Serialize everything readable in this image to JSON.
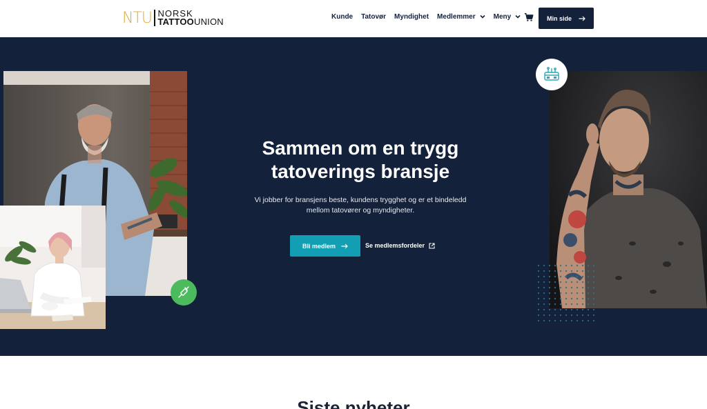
{
  "header": {
    "logo": {
      "mark": "NTU",
      "word1": "NORSK",
      "word2_bold": "TATTOO",
      "word2_rest": "UNION"
    },
    "nav": [
      {
        "label": "Kunde",
        "dropdown": false
      },
      {
        "label": "Tatovør",
        "dropdown": false
      },
      {
        "label": "Myndighet",
        "dropdown": false
      },
      {
        "label": "Medlemmer",
        "dropdown": true
      },
      {
        "label": "Meny",
        "dropdown": true
      }
    ],
    "cart_icon": "cart-icon",
    "cta_label": "Min side"
  },
  "hero": {
    "title": "Sammen om en trygg tatoverings bransje",
    "subtitle": "Vi jobber for bransjens beste, kundens trygghet og er et bindeledd mellom tatovører og myndigheter.",
    "primary_button": "Bli medlem",
    "secondary_link": "Se medlemsfordeler",
    "colors": {
      "background": "#14213a",
      "primary_button": "#139fb3",
      "green_badge": "#4cbb5e"
    }
  },
  "news": {
    "title": "Siste nyheter"
  }
}
